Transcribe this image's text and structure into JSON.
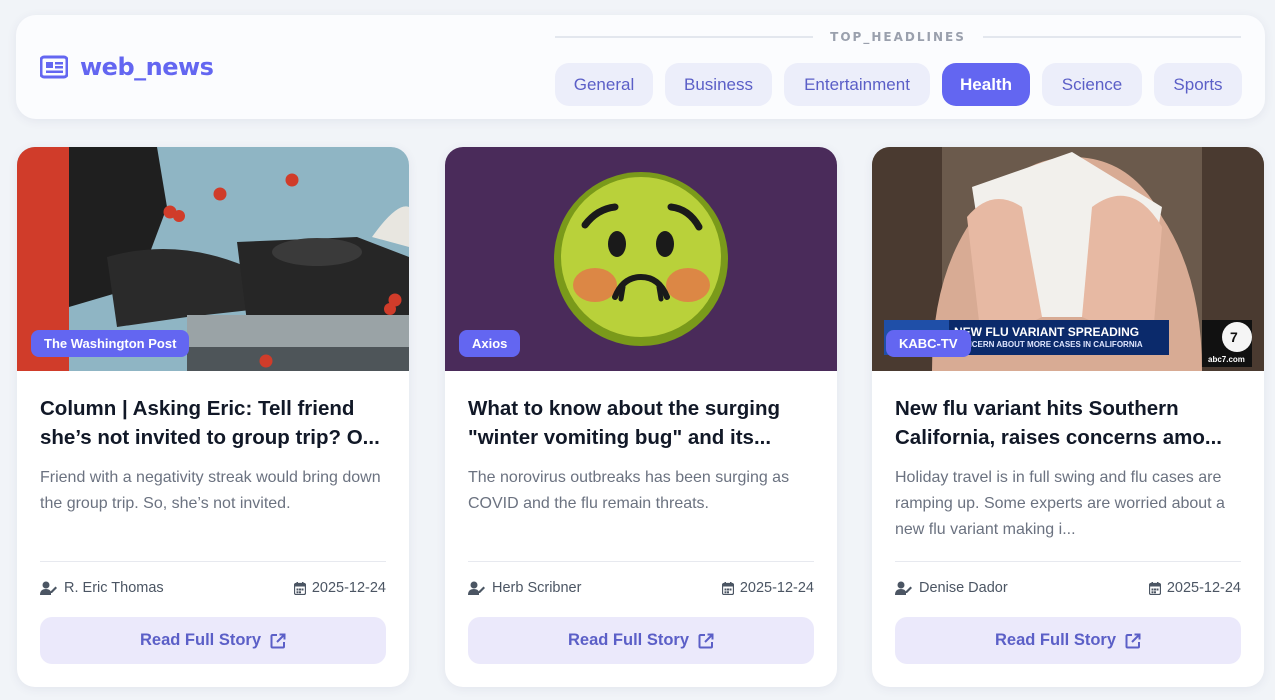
{
  "brand": {
    "name": "web_news",
    "icon": "newspaper-icon"
  },
  "section_label": "TOP_HEADLINES",
  "colors": {
    "accent": "#6366f1",
    "accent_soft": "#ebe9fb",
    "page_bg": "#f1f4f8"
  },
  "tabs": [
    {
      "label": "General",
      "active": false
    },
    {
      "label": "Business",
      "active": false
    },
    {
      "label": "Entertainment",
      "active": false
    },
    {
      "label": "Health",
      "active": true
    },
    {
      "label": "Science",
      "active": false
    },
    {
      "label": "Sports",
      "active": false
    }
  ],
  "articles": [
    {
      "source": "The Washington Post",
      "title": "Column | Asking Eric: Tell friend she’s not invited to group trip? O...",
      "description": "Friend with a negativity streak would bring down the group trip. So, she’s not invited.",
      "author": "R. Eric Thomas",
      "date": "2025-12-24",
      "cta": "Read Full Story",
      "image": "illustration of hands typing on a typewriter with red dots"
    },
    {
      "source": "Axios",
      "title": "What to know about the surging \"winter vomiting bug\" and its...",
      "description": "The norovirus outbreaks has been surging as COVID and the flu remain threats.",
      "author": "Herb Scribner",
      "date": "2025-12-24",
      "cta": "Read Full Story",
      "image": "nauseated face emoji on purple background"
    },
    {
      "source": "KABC-TV",
      "title": "New flu variant hits Southern California, raises concerns amo...",
      "description": "Holiday travel is in full swing and flu cases are ramping up. Some experts are worried about a new flu variant making i...",
      "author": "Denise Dador",
      "date": "2025-12-24",
      "cta": "Read Full Story",
      "image": "person blowing nose into tissue",
      "ticker": {
        "headline": "NEW FLU VARIANT SPREADING",
        "subline": "CONCERN ABOUT MORE CASES IN CALIFORNIA",
        "channel": "abc7.com"
      }
    }
  ]
}
